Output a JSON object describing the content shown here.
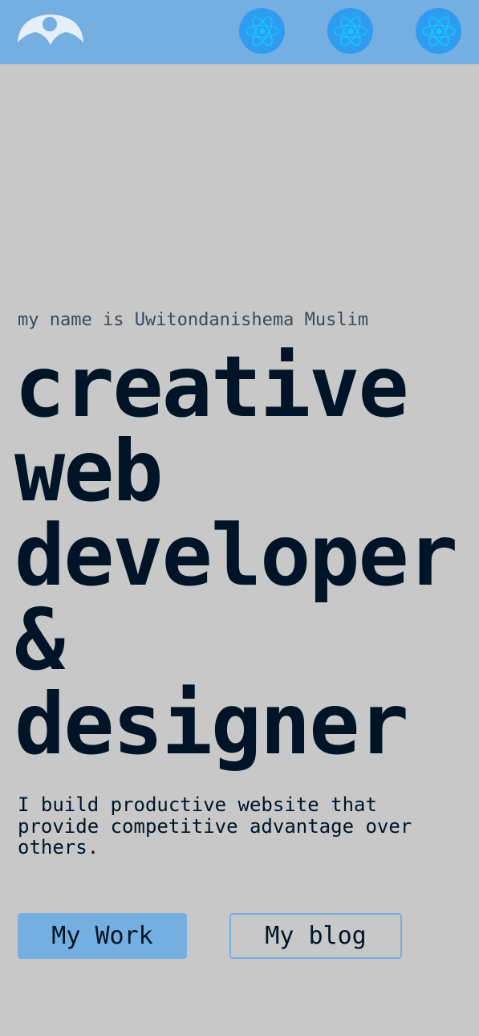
{
  "header": {
    "logo": "logo-emblem-icon",
    "nav_icons": [
      "react-icon",
      "react-icon",
      "react-icon"
    ],
    "colors": {
      "bar": "#75aee0",
      "icon_bg": "#2f9cf0",
      "icon_fg": "#12c6ff"
    }
  },
  "hero": {
    "intro": "my name is Uwitondanishema Muslim",
    "headline_lines": [
      "creative",
      "web",
      "developer",
      "&",
      "designer"
    ],
    "description": "I build productive website that provide competitive advantage over others.",
    "primary_button": "My Work",
    "secondary_button": "My blog"
  },
  "colors": {
    "background": "#c8c8c8",
    "text_dark": "#001428",
    "text_muted": "#3f4a55",
    "accent": "#75aee0"
  }
}
